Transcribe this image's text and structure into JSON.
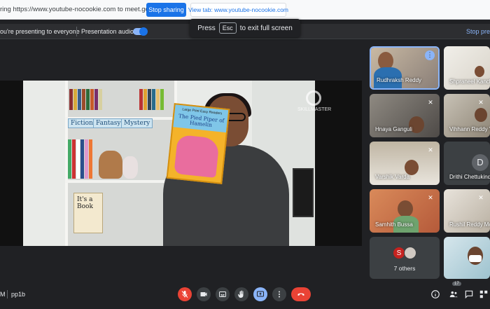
{
  "chrome_bar": {
    "share_text": "ring https://www.youtube-nocookie.com to meet.google.com",
    "stop_sharing": "Stop sharing",
    "view_tab": "View tab: www.youtube-nocookie.com"
  },
  "present_bar": {
    "presenting_text": "ou're presenting to everyone",
    "audio_label": "Presentation audio",
    "audio_on": true,
    "stop_presenting": "Stop pre"
  },
  "esc_tip": {
    "before": "Press",
    "key": "Esc",
    "after": "to exit full screen"
  },
  "main_video": {
    "shelf_labels": [
      "Fiction",
      "Fantasy",
      "Mystery"
    ],
    "book_series": "Large Print Easy Readers",
    "book_title": "The Pied Piper of Hamelin",
    "watermark": "SKILLMASTER",
    "shelf_book": "It's a Book"
  },
  "participants": [
    {
      "name": "Rudhraksh Reddy",
      "active": true,
      "menu": "⋮"
    },
    {
      "name": "Shpraneel Kanch"
    },
    {
      "name": "Hnaya Ganguli",
      "muted": true
    },
    {
      "name": "Vihhann Reddy Y",
      "muted": true
    },
    {
      "name": "Varshik Varda",
      "muted": true
    },
    {
      "name": "Drithi Chettukind",
      "initial": "D"
    },
    {
      "name": "Samhith Bussa",
      "muted": true
    },
    {
      "name": "Rushil Reddy Mc",
      "muted": true
    },
    {
      "name": "7 others",
      "avatar_letter": "S"
    },
    {
      "name": ""
    }
  ],
  "bottom_bar": {
    "time": "M",
    "meeting_code": "pp1b",
    "people_count": "17"
  },
  "colors": {
    "background": "#202124",
    "tile": "#3c4043",
    "accent_blue": "#1a73e8",
    "light_blue": "#8ab4f8",
    "end_call_red": "#ea4335"
  },
  "icons": [
    "mic-off-icon",
    "camera-icon",
    "captions-icon",
    "raise-hand-icon",
    "present-icon",
    "more-icon",
    "end-call-icon",
    "info-icon",
    "people-icon",
    "chat-icon",
    "activities-icon"
  ]
}
